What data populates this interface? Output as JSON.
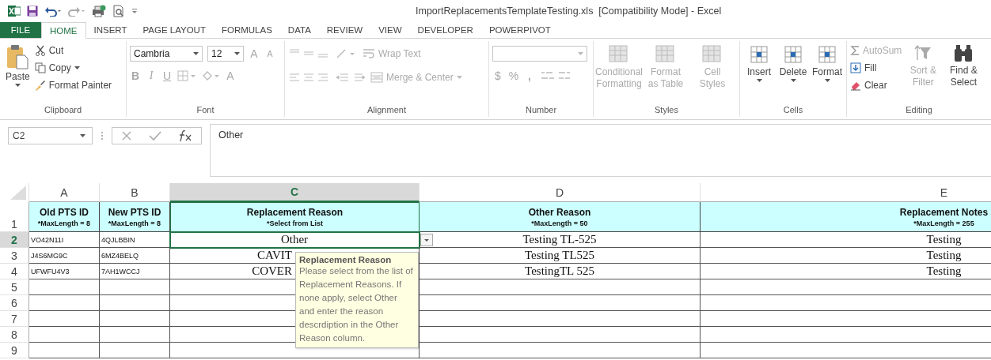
{
  "window": {
    "title": "ImportReplacementsTemplateTesting.xls  [Compatibility Mode] - Excel"
  },
  "ribbon_tabs": [
    {
      "label": "FILE",
      "kind": "file",
      "selected": false
    },
    {
      "label": "HOME",
      "kind": "tab",
      "selected": true
    },
    {
      "label": "INSERT",
      "kind": "tab",
      "selected": false
    },
    {
      "label": "PAGE LAYOUT",
      "kind": "tab",
      "selected": false
    },
    {
      "label": "FORMULAS",
      "kind": "tab",
      "selected": false
    },
    {
      "label": "DATA",
      "kind": "tab",
      "selected": false
    },
    {
      "label": "REVIEW",
      "kind": "tab",
      "selected": false
    },
    {
      "label": "VIEW",
      "kind": "tab",
      "selected": false
    },
    {
      "label": "DEVELOPER",
      "kind": "tab",
      "selected": false
    },
    {
      "label": "POWERPIVOT",
      "kind": "tab",
      "selected": false
    }
  ],
  "clipboard": {
    "label": "Clipboard",
    "paste": "Paste",
    "cut": "Cut",
    "copy": "Copy",
    "format_painter": "Format Painter"
  },
  "font": {
    "label": "Font",
    "font_name": "Cambria",
    "font_size": "12",
    "grow": "A",
    "shrink": "A",
    "bold": "B",
    "italic": "I",
    "underline": "U",
    "font_color": "A"
  },
  "alignment": {
    "label": "Alignment",
    "wrap_text": "Wrap Text",
    "merge_center": "Merge & Center"
  },
  "number": {
    "label": "Number",
    "currency": "$",
    "percent": "%",
    "comma": ","
  },
  "styles": {
    "label": "Styles",
    "buttons": [
      {
        "label": "Conditional Formatting",
        "disabled": true
      },
      {
        "label": "Format as Table",
        "disabled": true
      },
      {
        "label": "Cell Styles",
        "disabled": true
      }
    ]
  },
  "cells": {
    "label": "Cells",
    "buttons": [
      {
        "label": "Insert",
        "disabled": false
      },
      {
        "label": "Delete",
        "disabled": false
      },
      {
        "label": "Format",
        "disabled": false
      }
    ]
  },
  "editing": {
    "label": "Editing",
    "autosum": {
      "label": "AutoSum",
      "disabled": true
    },
    "fill": {
      "label": "Fill",
      "disabled": false
    },
    "clear": {
      "label": "Clear",
      "disabled": false
    },
    "sort_filter": {
      "label": "Sort & Filter",
      "disabled": true
    },
    "find_select": {
      "label": "Find & Select",
      "disabled": false
    }
  },
  "formula_bar": {
    "name_box": "C2",
    "content": "Other"
  },
  "sheet": {
    "columns": [
      {
        "letter": "A",
        "selected": false
      },
      {
        "letter": "B",
        "selected": false
      },
      {
        "letter": "C",
        "selected": true
      },
      {
        "letter": "D",
        "selected": false
      },
      {
        "letter": "E",
        "selected": false
      }
    ],
    "header_row": {
      "number": "1",
      "selected": false,
      "cells": [
        {
          "title": "Old PTS ID",
          "note": "*MaxLength = 8"
        },
        {
          "title": "New PTS ID",
          "note": "*MaxLength = 8"
        },
        {
          "title": "Replacement Reason",
          "note": "*Select from List"
        },
        {
          "title": "Other Reason",
          "note": "*MaxLength = 50"
        },
        {
          "title": "Replacement Notes",
          "note": "*MaxLength = 255"
        }
      ]
    },
    "rows": [
      {
        "number": "2",
        "selected": true,
        "cells": [
          "VO42N11I",
          "4QJLBBIN",
          "Other",
          "Testing TL-525",
          "Testing"
        ]
      },
      {
        "number": "3",
        "selected": false,
        "cells": [
          "J4S6MG9C",
          "6MZ4BELQ",
          "CAVIT",
          "Testing TL525",
          "Testing"
        ]
      },
      {
        "number": "4",
        "selected": false,
        "cells": [
          "UFWFU4V3",
          "7AH1WCCJ",
          "COVER",
          "TestingTL 525",
          "Testing"
        ]
      },
      {
        "number": "5",
        "selected": false,
        "cells": []
      },
      {
        "number": "6",
        "selected": false,
        "cells": []
      },
      {
        "number": "7",
        "selected": false,
        "cells": []
      },
      {
        "number": "8",
        "selected": false,
        "cells": []
      },
      {
        "number": "9",
        "selected": false,
        "cells": []
      }
    ]
  },
  "tooltip": {
    "title": "Replacement Reason",
    "text": "Please select from the list of Replacement Reasons. If none apply, select Other and enter the reason descrdiption in the Other Reason column."
  }
}
